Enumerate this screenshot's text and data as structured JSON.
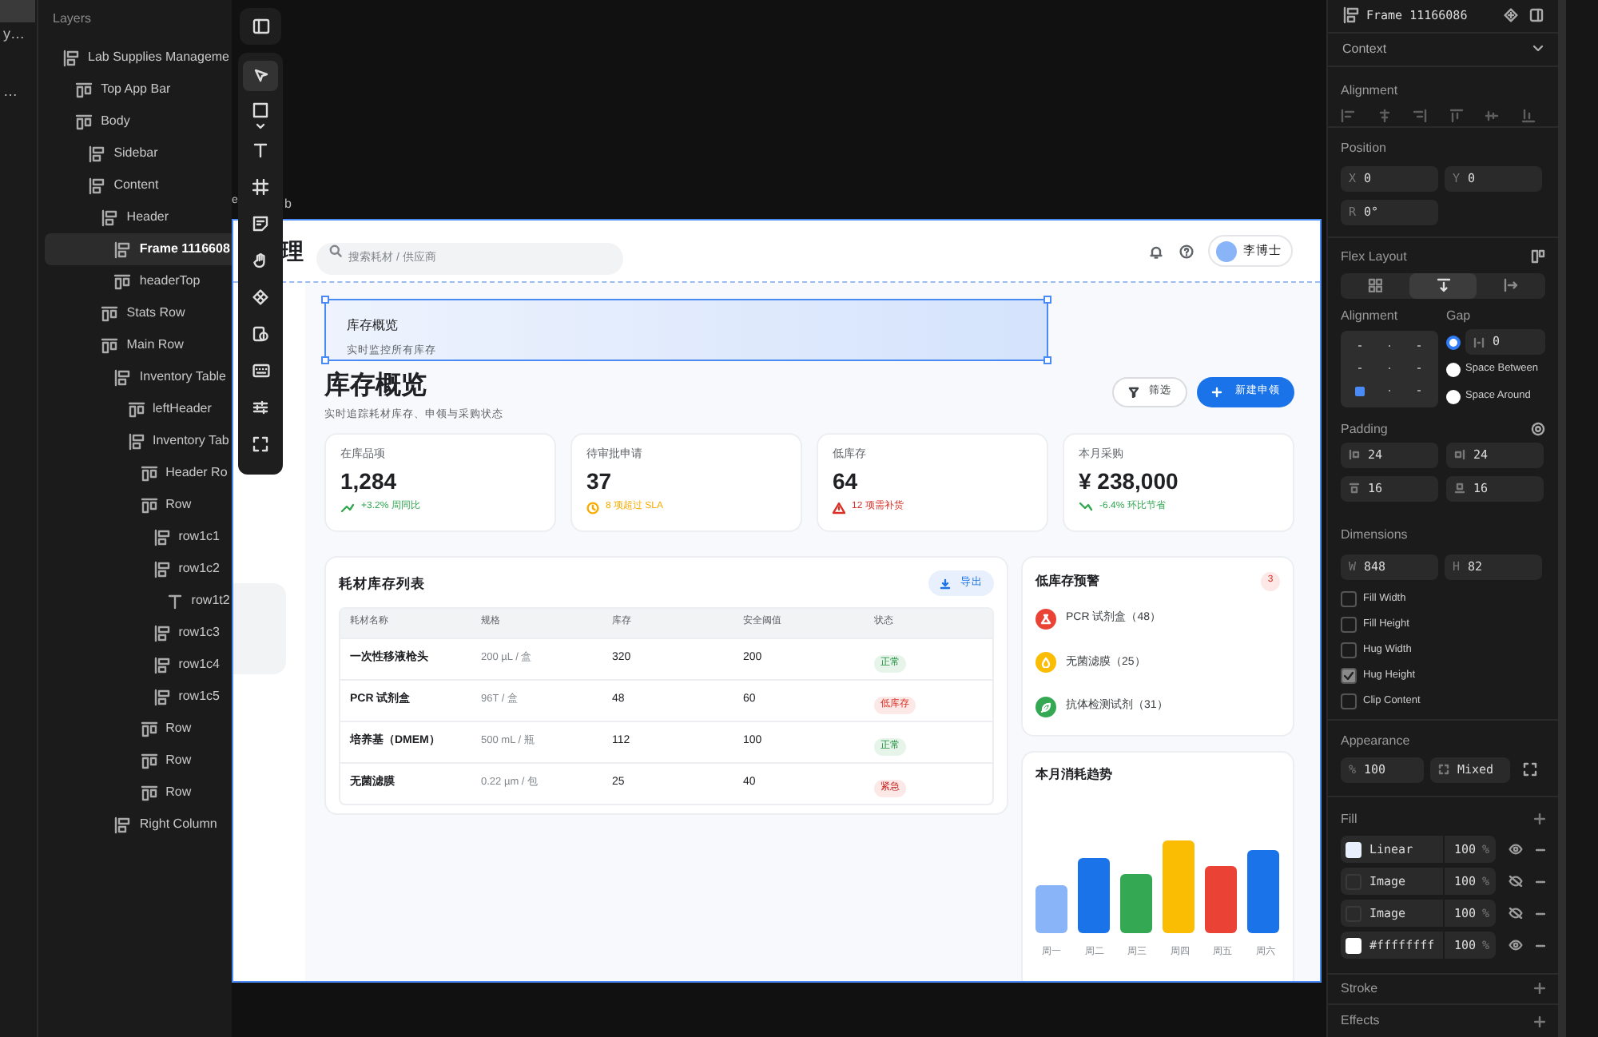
{
  "left_strip": {
    "texts": [
      "y…",
      "…"
    ]
  },
  "layers": {
    "title": "Layers",
    "tree": [
      {
        "name": "Lab Supplies Manageme",
        "kind": "stack",
        "selected": false,
        "children": [
          {
            "name": "Top App Bar",
            "kind": "row",
            "selected": false
          },
          {
            "name": "Body",
            "kind": "row",
            "selected": false,
            "children": [
              {
                "name": "Sidebar",
                "kind": "stack",
                "selected": false
              },
              {
                "name": "Content",
                "kind": "stack",
                "selected": false,
                "children": [
                  {
                    "name": "Header",
                    "kind": "stack",
                    "selected": false,
                    "children": [
                      {
                        "name": "Frame 1116608",
                        "kind": "stack",
                        "selected": true
                      },
                      {
                        "name": "headerTop",
                        "kind": "row",
                        "selected": false
                      }
                    ]
                  },
                  {
                    "name": "Stats Row",
                    "kind": "row",
                    "selected": false
                  },
                  {
                    "name": "Main Row",
                    "kind": "row",
                    "selected": false,
                    "children": [
                      {
                        "name": "Inventory Table",
                        "kind": "stack",
                        "selected": false,
                        "children": [
                          {
                            "name": "leftHeader",
                            "kind": "row",
                            "selected": false
                          },
                          {
                            "name": "Inventory Tab",
                            "kind": "stack",
                            "selected": false,
                            "children": [
                              {
                                "name": "Header Ro",
                                "kind": "row",
                                "selected": false
                              },
                              {
                                "name": "Row",
                                "kind": "row",
                                "selected": false,
                                "children": [
                                  {
                                    "name": "row1c1",
                                    "kind": "stack",
                                    "selected": false
                                  },
                                  {
                                    "name": "row1c2",
                                    "kind": "stack",
                                    "selected": false,
                                    "children": [
                                      {
                                        "name": "row1t2",
                                        "kind": "text",
                                        "selected": false
                                      }
                                    ]
                                  },
                                  {
                                    "name": "row1c3",
                                    "kind": "stack",
                                    "selected": false
                                  },
                                  {
                                    "name": "row1c4",
                                    "kind": "stack",
                                    "selected": false
                                  },
                                  {
                                    "name": "row1c5",
                                    "kind": "stack",
                                    "selected": false
                                  }
                                ]
                              },
                              {
                                "name": "Row",
                                "kind": "row",
                                "selected": false
                              },
                              {
                                "name": "Row",
                                "kind": "row",
                                "selected": false
                              },
                              {
                                "name": "Row",
                                "kind": "row",
                                "selected": false
                              }
                            ]
                          }
                        ]
                      },
                      {
                        "name": "Right Column",
                        "kind": "stack",
                        "selected": false
                      }
                    ]
                  }
                ]
              }
            ]
          }
        ]
      }
    ]
  },
  "canvas": {
    "frame_label_parts": [
      "e",
      "b"
    ]
  },
  "app": {
    "title_tail": "理",
    "search": {
      "placeholder": "搜索耗材 / 供应商"
    },
    "user": "李博士",
    "selected_frame": {
      "title": "库存概览",
      "subtitle": "实时监控所有库存"
    },
    "header": {
      "title": "库存概览",
      "subtitle": "实时追踪耗材库存、申领与采购状态",
      "filter_button": "筛选",
      "new_button": "新建申领"
    },
    "stats": [
      {
        "label": "在库品项",
        "value": "1,284",
        "note": "+3.2% 周同比",
        "kind": "trend_up"
      },
      {
        "label": "待审批申请",
        "value": "37",
        "note": "8 项超过 SLA",
        "kind": "pending"
      },
      {
        "label": "低库存",
        "value": "64",
        "note": "12 项需补货",
        "kind": "warning"
      },
      {
        "label": "本月采购",
        "value": "¥ 238,000",
        "note": "-6.4% 环比节省",
        "kind": "trend_down"
      }
    ],
    "inventory": {
      "title": "耗材库存列表",
      "export_button": "导出",
      "columns": [
        "耗材名称",
        "规格",
        "库存",
        "安全阈值",
        "状态"
      ],
      "rows": [
        {
          "name": "一次性移液枪头",
          "spec": "200 µL / 盒",
          "stock": "320",
          "threshold": "200",
          "status": "正常",
          "kind": "normal"
        },
        {
          "name": "PCR 试剂盒",
          "spec": "96T / 盒",
          "stock": "48",
          "threshold": "60",
          "status": "低库存",
          "kind": "low"
        },
        {
          "name": "培养基（DMEM）",
          "spec": "500 mL / 瓶",
          "stock": "112",
          "threshold": "100",
          "status": "正常",
          "kind": "normal"
        },
        {
          "name": "无菌滤膜",
          "spec": "0.22 µm / 包",
          "stock": "25",
          "threshold": "40",
          "status": "紧急",
          "kind": "urgent"
        }
      ]
    },
    "low_stock": {
      "title": "低库存预警",
      "count": "3",
      "items": [
        {
          "label": "PCR 试剂盒（48）",
          "color": "#ea4335",
          "kind": "flask"
        },
        {
          "label": "无菌滤膜（25）",
          "color": "#fbbc04",
          "kind": "drop"
        },
        {
          "label": "抗体检测试剂（31）",
          "color": "#34a853",
          "kind": "leaf"
        }
      ]
    },
    "trend": {
      "title": "本月消耗趋势",
      "days": [
        "周一",
        "周二",
        "周三",
        "周四",
        "周五",
        "周六"
      ]
    }
  },
  "inspector": {
    "frame_name": "Frame 11166086",
    "context": "Context",
    "alignment_title": "Alignment",
    "position": {
      "title": "Position",
      "x": {
        "label": "X",
        "value": "0"
      },
      "y": {
        "label": "Y",
        "value": "0"
      },
      "r": {
        "label": "R",
        "value": "0°"
      }
    },
    "flex": {
      "title": "Flex Layout",
      "directions": [
        {
          "kind": "wrap",
          "selected": false
        },
        {
          "kind": "vertical",
          "selected": true
        },
        {
          "kind": "horizontal",
          "selected": false
        }
      ],
      "alignment_label": "Alignment",
      "gap_label": "Gap",
      "cells": [
        {
          "selected": false
        },
        {
          "selected": false
        },
        {
          "selected": false
        },
        {
          "selected": false
        },
        {
          "selected": false
        },
        {
          "selected": false
        },
        {
          "selected": true
        },
        {
          "selected": false
        },
        {
          "selected": false
        }
      ],
      "gap_options": [
        {
          "kind": "value",
          "text": "0",
          "selected": true
        },
        {
          "kind": "label",
          "text": "Space Between",
          "selected": false
        },
        {
          "kind": "label",
          "text": "Space Around",
          "selected": false
        }
      ]
    },
    "padding": {
      "title": "Padding",
      "values": [
        "24",
        "24",
        "16",
        "16"
      ]
    },
    "dimensions": {
      "title": "Dimensions",
      "w": {
        "label": "W",
        "value": "848"
      },
      "h": {
        "label": "H",
        "value": "82"
      }
    },
    "options": [
      {
        "label": "Fill Width",
        "checked": false
      },
      {
        "label": "Fill Height",
        "checked": false
      },
      {
        "label": "Hug Width",
        "checked": false
      },
      {
        "label": "Hug Height",
        "checked": true
      },
      {
        "label": "Clip Content",
        "checked": false
      }
    ],
    "appearance": {
      "title": "Appearance",
      "opacity": {
        "label": "%",
        "value": "100"
      },
      "radius": "Mixed"
    },
    "fill": {
      "title": "Fill",
      "layers": [
        {
          "kind": "linear",
          "name": "Linear",
          "opacity": "100",
          "unit": "%",
          "color": "#e8f0fe",
          "visible": true
        },
        {
          "kind": "image",
          "name": "Image",
          "opacity": "100",
          "unit": "%",
          "visible": false
        },
        {
          "kind": "image",
          "name": "Image",
          "opacity": "100",
          "unit": "%",
          "visible": false
        },
        {
          "kind": "solid",
          "name": "#ffffffff",
          "opacity": "100",
          "unit": "%",
          "color": "#ffffff",
          "visible": true
        }
      ]
    },
    "stroke_title": "Stroke",
    "effects_title": "Effects"
  }
}
